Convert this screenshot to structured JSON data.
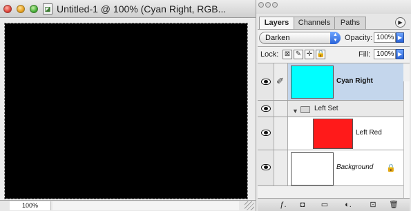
{
  "document": {
    "title": "Untitled-1 @ 100% (Cyan Right, RGB...",
    "doc_icon_glyph": "◪",
    "zoom": "100%",
    "canvas_color": "#000000"
  },
  "palette": {
    "tabs": [
      {
        "label": "Layers",
        "active": true
      },
      {
        "label": "Channels",
        "active": false
      },
      {
        "label": "Paths",
        "active": false
      }
    ],
    "menu_glyph": "▶",
    "blend_mode": "Darken",
    "opacity_label": "Opacity:",
    "opacity_value": "100%",
    "lock_label": "Lock:",
    "fill_label": "Fill:",
    "fill_value": "100%",
    "lock_icons": {
      "transparent": "⊠",
      "image": "✎",
      "position": "✛",
      "all": "🔒"
    },
    "layers": [
      {
        "name": "Cyan Right",
        "color": "#00ffff",
        "selected": true,
        "visible": true,
        "style": "bold",
        "brush": "✐"
      },
      {
        "name": "Left Set",
        "type": "set",
        "expanded": true,
        "visible": true
      },
      {
        "name": "Left Red",
        "color": "#ff1a1a",
        "visible": true,
        "style": "normal"
      },
      {
        "name": "Background",
        "color": "#ffffff",
        "visible": true,
        "style": "italic",
        "locked": true,
        "lock_glyph": "🔒"
      }
    ],
    "bottom_buttons": [
      "ƒ.",
      "◘",
      "▭",
      "◐.",
      "⊡",
      "🗑"
    ]
  },
  "colors": {
    "selection_highlight": "#c4d6ec",
    "accent_blue": "#2a63d8"
  }
}
